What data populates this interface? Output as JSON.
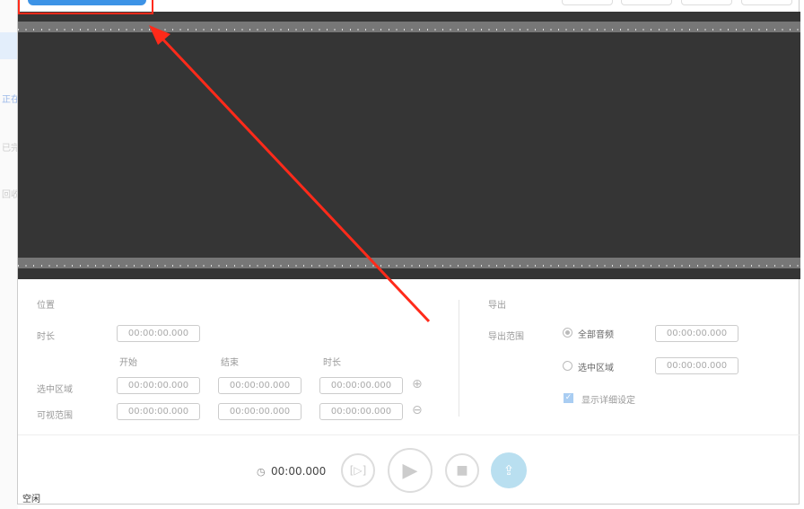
{
  "sidebar": {
    "items": [
      "正在",
      "已完",
      "回收"
    ]
  },
  "position": {
    "title": "位置",
    "duration_label": "时长",
    "duration_value": "00:00:00.000",
    "col_start": "开始",
    "col_end": "结束",
    "col_duration": "时长",
    "selection_label": "选中区域",
    "selection": [
      "00:00:00.000",
      "00:00:00.000",
      "00:00:00.000"
    ],
    "visible_label": "可视范围",
    "visible": [
      "00:00:00.000",
      "00:00:00.000",
      "00:00:00.000"
    ]
  },
  "export": {
    "title": "导出",
    "range_label": "导出范围",
    "all_audio": "全部音频",
    "all_audio_value": "00:00:00.000",
    "selected_region": "选中区域",
    "selected_region_value": "00:00:00.000",
    "show_details": "显示详细设定"
  },
  "player": {
    "time": "00:00.000"
  },
  "status": "空闲",
  "colors": {
    "accent": "#3d93e6",
    "annotation": "#ff2a1a",
    "export_button": "#b9dff0"
  }
}
